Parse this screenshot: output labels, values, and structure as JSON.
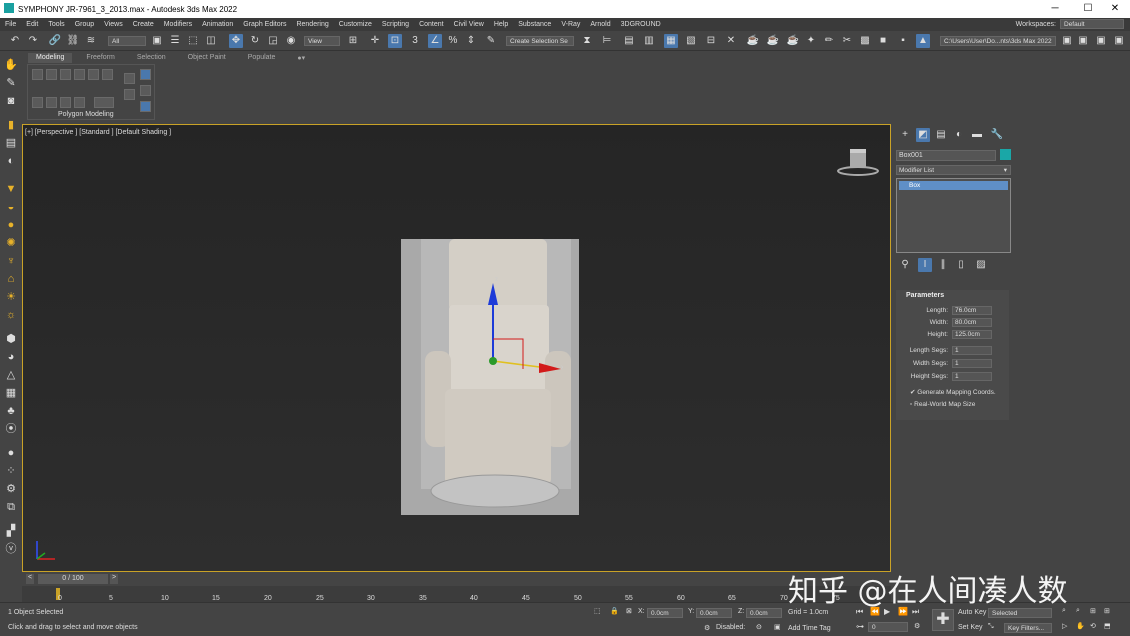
{
  "window": {
    "title": "SYMPHONY JR-7961_3_2013.max - Autodesk 3ds Max 2022",
    "min": "─",
    "max": "☐",
    "close": "✕"
  },
  "menu": {
    "items": [
      "File",
      "Edit",
      "Tools",
      "Group",
      "Views",
      "Create",
      "Modifiers",
      "Animation",
      "Graph Editors",
      "Rendering",
      "Customize",
      "Scripting",
      "Content",
      "Civil View",
      "Help",
      "Substance",
      "V-Ray",
      "Arnold",
      "3DGROUND"
    ],
    "workspaces_label": "Workspaces:",
    "workspaces_value": "Default"
  },
  "toolbar": {
    "filter": "All",
    "view": "View",
    "selection_set": "Create Selection Se",
    "path": "C:\\Users\\User\\Do...nts\\3ds Max 2022"
  },
  "ribbon": {
    "tabs": [
      "Modeling",
      "Freeform",
      "Selection",
      "Object Paint",
      "Populate"
    ],
    "group_label": "Polygon Modeling"
  },
  "viewport": {
    "label": "[+] [Perspective ] [Standard ] [Default Shading ]",
    "axis_z": "z",
    "axis_x": "x"
  },
  "command_panel": {
    "object_name": "Box001",
    "object_color": "#1aa7a7",
    "modifier_list": "Modifier List",
    "stack_item": "Box",
    "params_title": "Parameters",
    "params": [
      {
        "label": "Length:",
        "value": "76.0cm"
      },
      {
        "label": "Width:",
        "value": "80.0cm"
      },
      {
        "label": "Height:",
        "value": "125.0cm"
      },
      {
        "label": "Length Segs:",
        "value": "1"
      },
      {
        "label": "Width Segs:",
        "value": "1"
      },
      {
        "label": "Height Segs:",
        "value": "1"
      }
    ],
    "gen_mapping": "Generate Mapping Coords.",
    "real_world": "Real-World Map Size"
  },
  "timeslider": {
    "frame": "0 / 100",
    "ticks": [
      "0",
      "5",
      "10",
      "15",
      "20",
      "25",
      "30",
      "35",
      "40",
      "45",
      "50",
      "55",
      "60",
      "65",
      "70",
      "75"
    ]
  },
  "status": {
    "selected": "1 Object Selected",
    "hint": "Click and drag to select and move objects",
    "x": "0.0cm",
    "y": "0.0cm",
    "z": "0.0cm",
    "grid": "Grid = 1.0cm",
    "disabled": "Disabled:",
    "add_time_tag": "Add Time Tag",
    "auto_key": "Auto Key",
    "selected_dd": "Selected",
    "set_key": "Set Key",
    "key_filters": "Key Filters...",
    "frame_field": "0"
  },
  "watermark": "知乎 @在人间凑人数"
}
